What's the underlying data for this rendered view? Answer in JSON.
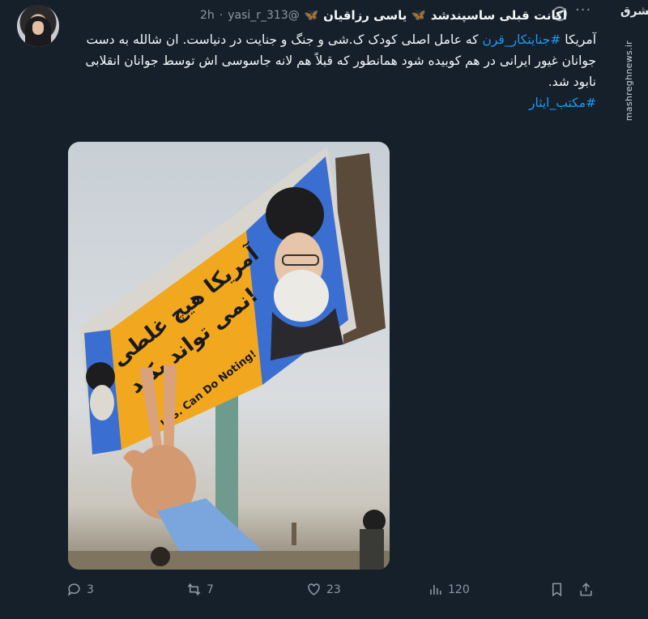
{
  "tweet": {
    "display_name": "یاسی رزاقیان",
    "display_name_suffix": "اکانت قبلی ساسپندشد",
    "handle": "@yasi_r_313",
    "dot": "·",
    "time": "2h",
    "body": {
      "part1": "آمریکا ",
      "hashtag1": "#جنایتکار_قرن",
      "part2": " که  عامل اصلی کودک ک.شی و جنگ و جنایت در دنیاست. ان شالله به دست جوانان غیور ایرانی در هم کوبیده شود همانطور که قبلاً هم لانه جاسوسی اش توسط جوانان انقلابی نابود شد.",
      "hashtag2": "#مکتب_ایثار"
    },
    "media": {
      "sign_text_line1": "آمریکا هیچ غلطی",
      "sign_text_line2": "نمی تواند بکند!",
      "sign_english": "U.S. Can Do Noting!"
    },
    "actions": {
      "replies": "3",
      "retweets": "7",
      "likes": "23",
      "views": "120"
    }
  },
  "watermark": {
    "logo": "مشرق",
    "site": "mashreghnews.ir"
  },
  "icons": [
    "grok-icon",
    "more-icon",
    "butterfly-icon",
    "reply-icon",
    "retweet-icon",
    "like-icon",
    "views-icon",
    "bookmark-icon",
    "share-icon"
  ],
  "colors": {
    "background": "#15202b",
    "accent": "#1d9bf0",
    "muted": "#8b98a5"
  }
}
